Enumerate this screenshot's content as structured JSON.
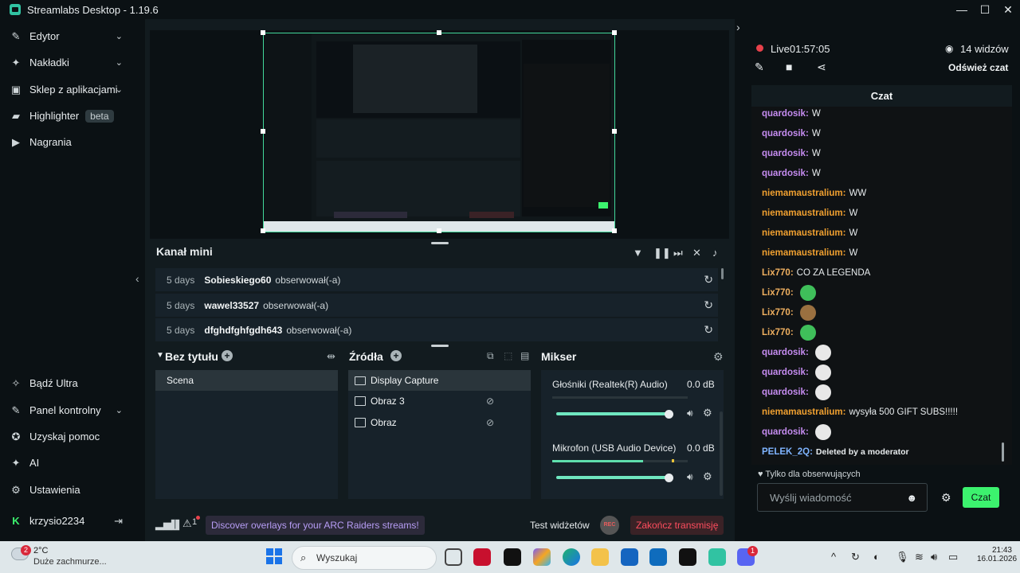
{
  "window": {
    "title": "Streamlabs Desktop - 1.19.6",
    "min": "—",
    "max": "☐",
    "close": "✕"
  },
  "sidebar": {
    "items": [
      {
        "label": "Edytor",
        "icon": "edit-tools-icon"
      },
      {
        "label": "Nakładki",
        "icon": "overlays-icon"
      },
      {
        "label": "Sklep z aplikacjami",
        "icon": "app-store-icon"
      },
      {
        "label": "Highlighter",
        "icon": "highlighter-icon",
        "badge": "beta"
      },
      {
        "label": "Nagrania",
        "icon": "recordings-icon"
      }
    ],
    "bottom": [
      {
        "label": "Bądź Ultra",
        "icon": "ultra-icon"
      },
      {
        "label": "Panel kontrolny",
        "icon": "dashboard-icon"
      },
      {
        "label": "Uzyskaj pomoc",
        "icon": "help-icon"
      },
      {
        "label": "AI",
        "icon": "ai-sparkle-icon"
      },
      {
        "label": "Ustawienia",
        "icon": "gear-icon"
      },
      {
        "label": "krzysio2234",
        "icon": "kick-logo-icon"
      }
    ]
  },
  "mini_feed": {
    "title": "Kanał mini",
    "rows": [
      {
        "time": "5 days",
        "user": "Sobieskiego60",
        "action": "obserwował(-a)"
      },
      {
        "time": "5 days",
        "user": "wawel33527",
        "action": "obserwował(-a)"
      },
      {
        "time": "5 days",
        "user": "dfghdfghfgdh643",
        "action": "obserwował(-a)"
      }
    ]
  },
  "scenes": {
    "title": "Bez tytułu",
    "items": [
      "Scena"
    ]
  },
  "sources": {
    "title": "Źródła",
    "items": [
      "Display Capture",
      "Obraz 3",
      "Obraz"
    ]
  },
  "mixer": {
    "title": "Mikser",
    "channels": [
      {
        "name": "Głośniki (Realtek(R) Audio)",
        "db": "0.0 dB",
        "level": 0,
        "volume": 1.0
      },
      {
        "name": "Mikrofon (USB Audio Device)",
        "db": "0.0 dB",
        "level": 0.67,
        "volume": 1.0
      }
    ]
  },
  "footer": {
    "promo": "Discover overlays for your ARC Raiders streams!",
    "alert_count": "1",
    "test_widgets": "Test widżetów",
    "rec": "REC",
    "end_stream": "Zakończ transmisję"
  },
  "chat": {
    "live_label": "Live",
    "live_time": "01:57:05",
    "viewers": "14 widzów",
    "refresh": "Odśwież czat",
    "header": "Czat",
    "messages": [
      {
        "nick": "quardosik",
        "text": "W",
        "color": "#c58cf0"
      },
      {
        "nick": "quardosik",
        "text": "W",
        "color": "#c58cf0"
      },
      {
        "nick": "quardosik",
        "text": "W",
        "color": "#c58cf0"
      },
      {
        "nick": "quardosik",
        "text": "W",
        "color": "#c58cf0"
      },
      {
        "nick": "niemamaustralium",
        "text": "WW",
        "color": "#f0a030"
      },
      {
        "nick": "niemamaustralium",
        "text": "W",
        "color": "#f0a030"
      },
      {
        "nick": "niemamaustralium",
        "text": "W",
        "color": "#f0a030"
      },
      {
        "nick": "niemamaustralium",
        "text": "W",
        "color": "#f0a030"
      },
      {
        "nick": "Lix770",
        "text": "CO ZA LEGENDA",
        "color": "#f0b060"
      },
      {
        "nick": "Lix770",
        "text": "",
        "emote": "green-face-emote",
        "color": "#f0b060"
      },
      {
        "nick": "Lix770",
        "text": "",
        "emote": "box-emote",
        "color": "#f0b060"
      },
      {
        "nick": "Lix770",
        "text": "",
        "emote": "green-face-emote",
        "color": "#f0b060"
      },
      {
        "nick": "quardosik",
        "text": "",
        "emote": "sunglasses-emote",
        "color": "#c58cf0"
      },
      {
        "nick": "quardosik",
        "text": "",
        "emote": "sunglasses-emote",
        "color": "#c58cf0"
      },
      {
        "nick": "quardosik",
        "text": "",
        "emote": "sunglasses-emote",
        "color": "#c58cf0"
      },
      {
        "nick": "niemamaustralium",
        "text": "wysyła 500 GIFT SUBS!!!!!",
        "color": "#f0a030"
      },
      {
        "nick": "quardosik",
        "text": "",
        "emote": "sunglasses-emote",
        "color": "#c58cf0"
      },
      {
        "nick": "PELEK_2Q",
        "text": "Deleted by a moderator",
        "color": "#7fb4ff"
      }
    ],
    "followers_only": "Tylko dla obserwujących",
    "input_placeholder": "Wyślij wiadomość",
    "send": "Czat"
  },
  "taskbar": {
    "weather_temp": "2°C",
    "weather_desc": "Duże zachmurze...",
    "weather_badge": "2",
    "search": "Wyszukaj",
    "discord_badge": "1",
    "time": "21:43",
    "date": "16.01.2026"
  },
  "colors": {
    "accent": "#31c3a2",
    "send": "#3cf26e",
    "danger": "#ff4d5e",
    "promo": "#b79df5"
  }
}
